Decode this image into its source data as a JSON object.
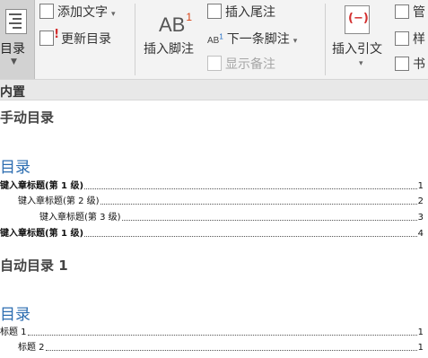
{
  "ribbon": {
    "toc_label": "目录",
    "add_text_label": "添加文字",
    "update_toc_label": "更新目录",
    "insert_footnote_label": "插入脚注",
    "insert_endnote_label": "插入尾注",
    "next_footnote_label": "下一条脚注",
    "show_notes_label": "显示备注",
    "insert_citation_label": "插入引文",
    "manage_label": "管",
    "style_label": "样",
    "bib_label": "书",
    "ab_big": "AB",
    "ab_big_sup": "1",
    "ab_small": "AB",
    "ab_small_sup": "1",
    "cite_glyph": "(−)"
  },
  "gallery": {
    "header": "内置",
    "sections": [
      {
        "title": "手动目录",
        "heading": "目录",
        "entries": [
          {
            "text": "键入章标题(第 1 级)",
            "page": "1"
          },
          {
            "text": "键入章标题(第 2 级)",
            "page": "2"
          },
          {
            "text": "键入章标题(第 3 级)",
            "page": "3"
          },
          {
            "text": "键入章标题(第 1 级)",
            "page": "4"
          }
        ]
      },
      {
        "title": "自动目录 1",
        "heading": "目录",
        "entries": [
          {
            "text": "标题 1",
            "page": "1"
          },
          {
            "text": "标题 2",
            "page": "1"
          }
        ]
      }
    ]
  }
}
